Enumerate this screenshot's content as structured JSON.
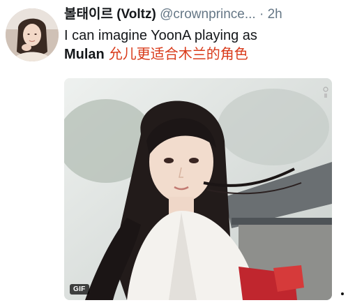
{
  "tweet": {
    "display_name": "볼태이르 (Voltz)",
    "handle": "@crownprince...",
    "separator": "·",
    "time": "2h",
    "text_line1": "I can imagine YoonA playing as",
    "text_bold": "Mulan",
    "overlay_cn": "允儿更适合木兰的角色"
  },
  "media": {
    "badge": "GIF"
  },
  "colors": {
    "name": "#14171a",
    "meta": "#657786",
    "overlay": "#d93a1a"
  },
  "icons": [
    "avatar-image",
    "gif-badge",
    "media-image"
  ]
}
